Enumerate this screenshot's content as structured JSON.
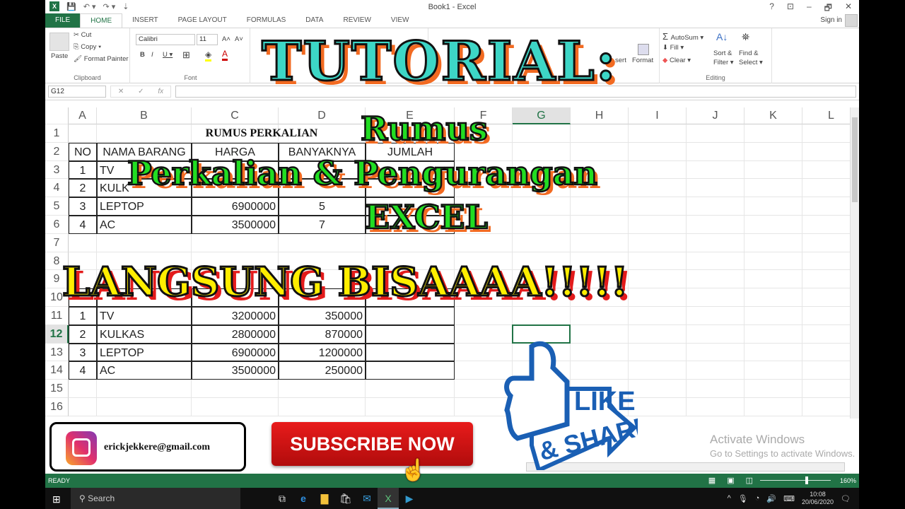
{
  "window": {
    "title": "Book1 - Excel",
    "help": "?",
    "restore": "⊡",
    "minimize": "–",
    "maximize": "🗗",
    "close": "✕"
  },
  "quick_access": {
    "save": "💾",
    "undo": "↶ ▾",
    "redo": "↷ ▾",
    "customize": "⇣"
  },
  "tabs": [
    "FILE",
    "HOME",
    "INSERT",
    "PAGE LAYOUT",
    "FORMULAS",
    "DATA",
    "REVIEW",
    "VIEW"
  ],
  "active_tab": "HOME",
  "signin": "Sign in",
  "ribbon": {
    "clipboard": {
      "label": "Clipboard",
      "paste": "Paste",
      "cut": "Cut",
      "copy": "Copy ▾",
      "format_painter": "Format Painter"
    },
    "font": {
      "label": "Font",
      "name": "Calibri",
      "size": "11",
      "bold": "B",
      "italic": "I",
      "underline": "U ▾",
      "grow": "A˄",
      "shrink": "A˅"
    },
    "cells": {
      "insert": "sert",
      "format": "Format"
    },
    "editing": {
      "label": "Editing",
      "autosum": "AutoSum ▾",
      "fill": "Fill ▾",
      "clear": "Clear ▾",
      "sort": "Sort &",
      "sort2": "Filter ▾",
      "find": "Find &",
      "find2": "Select ▾"
    }
  },
  "formula_bar": {
    "name_box": "G12",
    "fx": "fx",
    "value": ""
  },
  "columns": [
    "A",
    "B",
    "C",
    "D",
    "E",
    "F",
    "G",
    "H",
    "I",
    "J",
    "K",
    "L"
  ],
  "selected_column": "G",
  "rows": [
    "1",
    "2",
    "3",
    "4",
    "5",
    "6",
    "7",
    "8",
    "9",
    "10",
    "11",
    "12",
    "13",
    "14",
    "15",
    "16"
  ],
  "selected_row": "12",
  "sheet": {
    "title": "RUMUS PERKALIAN",
    "headers": [
      "NO",
      "NAMA BARANG",
      "HARGA",
      "BANYAKNYA",
      "JUMLAH"
    ],
    "table1": [
      {
        "no": "1",
        "nama": "TV",
        "harga": "",
        "banyak": ""
      },
      {
        "no": "2",
        "nama": "KULK",
        "harga": "",
        "banyak": ""
      },
      {
        "no": "3",
        "nama": "LEPTOP",
        "harga": "6900000",
        "banyak": "5"
      },
      {
        "no": "4",
        "nama": "AC",
        "harga": "3500000",
        "banyak": "7"
      }
    ],
    "table2": [
      {
        "no": "1",
        "nama": "TV",
        "harga": "3200000",
        "val": "350000"
      },
      {
        "no": "2",
        "nama": "KULKAS",
        "harga": "2800000",
        "val": "870000"
      },
      {
        "no": "3",
        "nama": "LEPTOP",
        "harga": "6900000",
        "val": "1200000"
      },
      {
        "no": "4",
        "nama": "AC",
        "harga": "3500000",
        "val": "250000"
      }
    ]
  },
  "overlay": {
    "tutorial": "TUTORIAL:",
    "line1": "Rumus",
    "line2": "Perkalian & Pengurangan",
    "line3": "EXCEL",
    "slogan": "LANGSUNG BISAAAA!!!!!",
    "email": "erickjekkere@gmail.com",
    "subscribe": "SUBSCRIBE NOW",
    "like": "LIKE",
    "share": "& SHARE"
  },
  "activation": {
    "title": "Activate Windows",
    "subtitle": "Go to Settings to activate Windows."
  },
  "status": {
    "ready": "READY",
    "zoom": "160%",
    "zoom_percent": 160
  },
  "taskbar": {
    "search": "Search",
    "time": "10:08",
    "date": "20/06/2020"
  }
}
